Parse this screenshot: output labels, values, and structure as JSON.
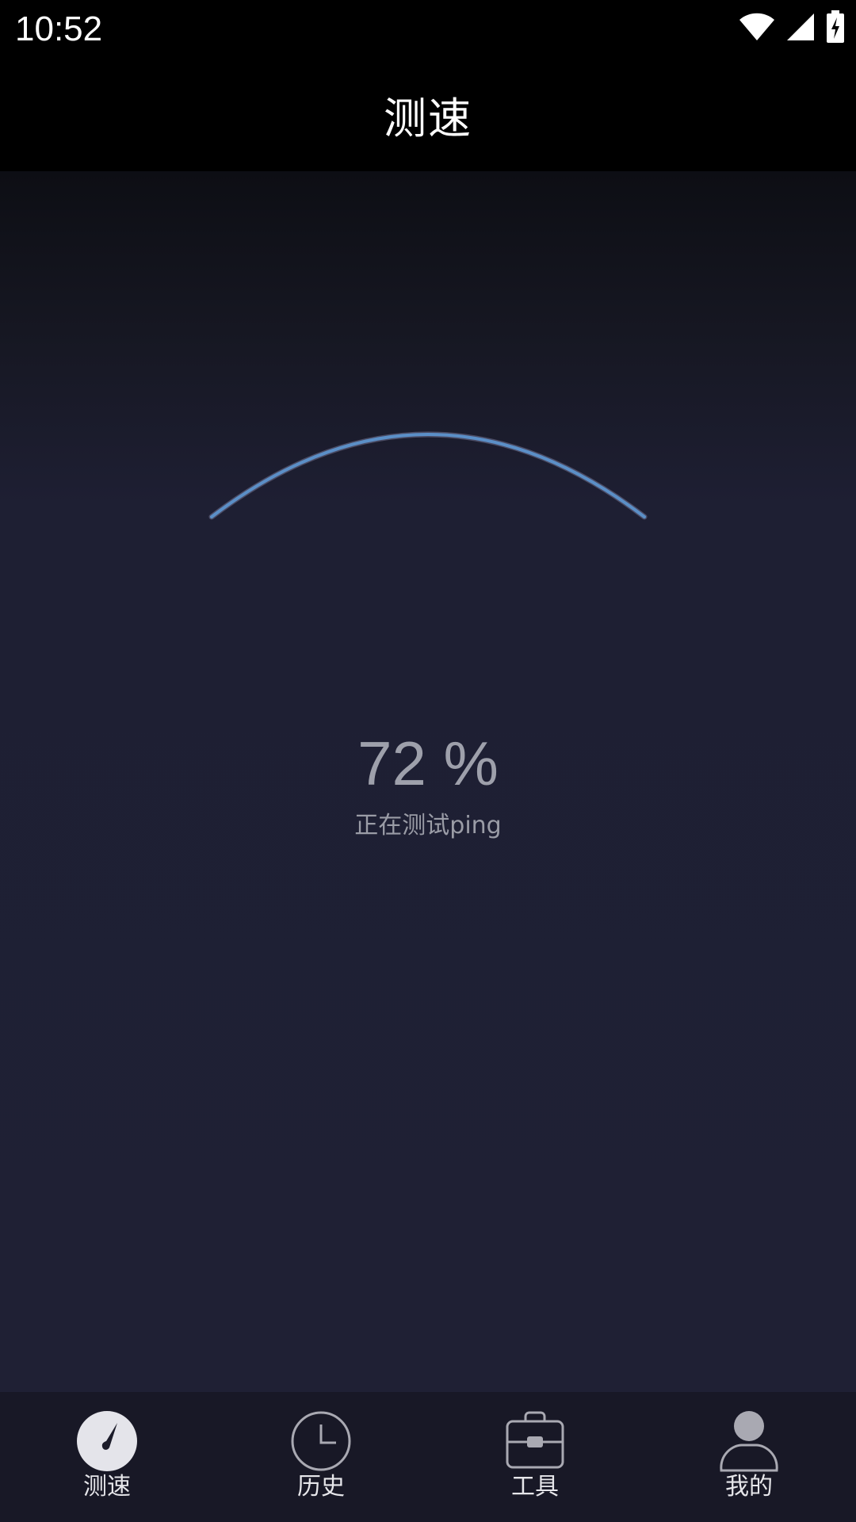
{
  "status_bar": {
    "time": "10:52",
    "icons": [
      "wifi-icon",
      "signal-icon",
      "battery-charging-icon"
    ]
  },
  "header": {
    "title": "测速"
  },
  "test": {
    "progress_text": "72 %",
    "progress_percent": 72,
    "status": "正在测试ping"
  },
  "colors": {
    "arc": "#5b8fc7",
    "background": "#1f2034",
    "header": "#000000",
    "nav_background": "#181826"
  },
  "nav": {
    "items": [
      {
        "label": "测速",
        "icon": "speedometer-icon",
        "active": true
      },
      {
        "label": "历史",
        "icon": "clock-icon",
        "active": false
      },
      {
        "label": "工具",
        "icon": "toolbox-icon",
        "active": false
      },
      {
        "label": "我的",
        "icon": "user-icon",
        "active": false
      }
    ]
  }
}
